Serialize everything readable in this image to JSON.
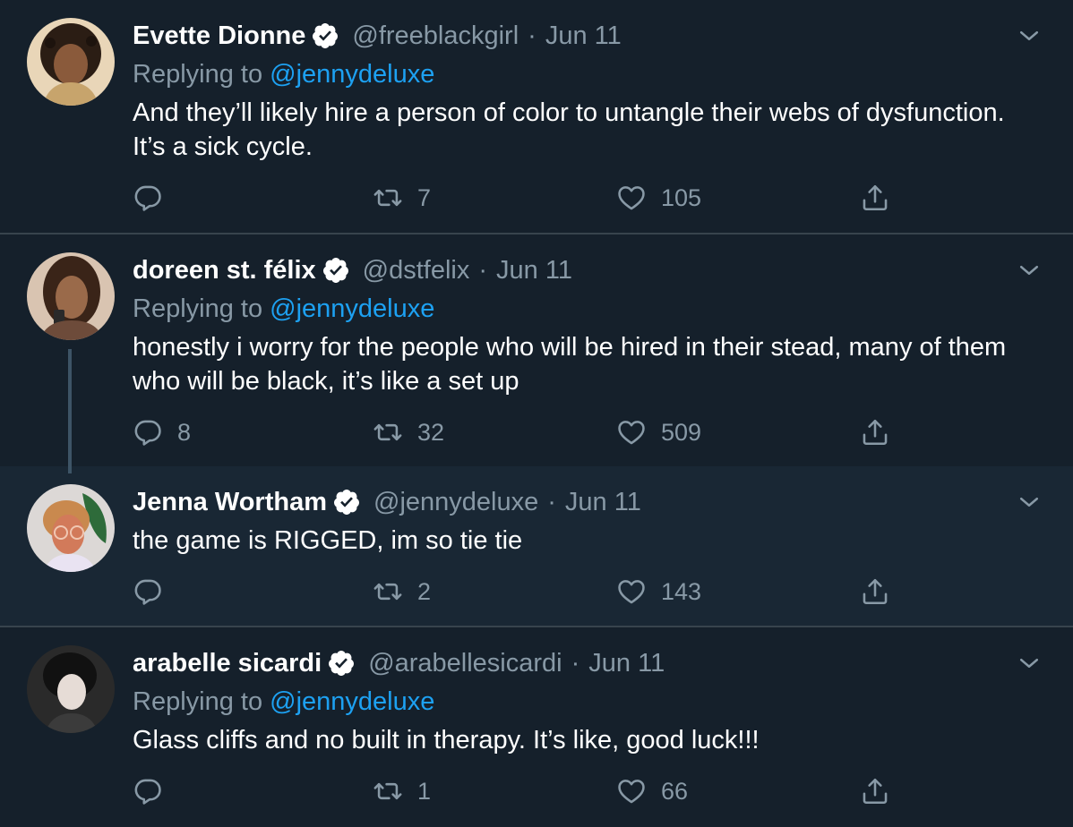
{
  "tweets": [
    {
      "name": "Evette Dionne",
      "handle": "@freeblackgirl",
      "separator": "·",
      "date": "Jun 11",
      "replying_prefix": "Replying to",
      "replying_to": "@jennydeluxe",
      "text": "And they’ll likely hire a person of color to untangle their webs of dysfunction. It’s a sick cycle.",
      "replies": "",
      "retweets": "7",
      "likes": "105"
    },
    {
      "name": "doreen st. félix",
      "handle": "@dstfelix",
      "separator": "·",
      "date": "Jun 11",
      "replying_prefix": "Replying to",
      "replying_to": "@jennydeluxe",
      "text": "honestly i worry for the people who will be hired in their stead, many of them who will be black, it’s like a set up",
      "replies": "8",
      "retweets": "32",
      "likes": "509"
    },
    {
      "name": "Jenna Wortham",
      "handle": "@jennydeluxe",
      "separator": "·",
      "date": "Jun 11",
      "text": "the game is RIGGED, im so tie tie",
      "replies": "",
      "retweets": "2",
      "likes": "143"
    },
    {
      "name": "arabelle sicardi",
      "handle": "@arabellesicardi",
      "separator": "·",
      "date": "Jun 11",
      "replying_prefix": "Replying to",
      "replying_to": "@jennydeluxe",
      "text": "Glass cliffs and no built in therapy. It’s like, good luck!!!",
      "replies": "",
      "retweets": "1",
      "likes": "66"
    }
  ],
  "icons": {
    "verified": "verified-badge-icon",
    "chevron": "chevron-down-icon",
    "reply": "reply-icon",
    "retweet": "retweet-icon",
    "like": "heart-icon",
    "share": "share-icon"
  },
  "colors": {
    "background": "#15202b",
    "highlight_background": "#192734",
    "divider": "#38444d",
    "secondary_text": "#8899a6",
    "accent": "#1da1f2"
  }
}
